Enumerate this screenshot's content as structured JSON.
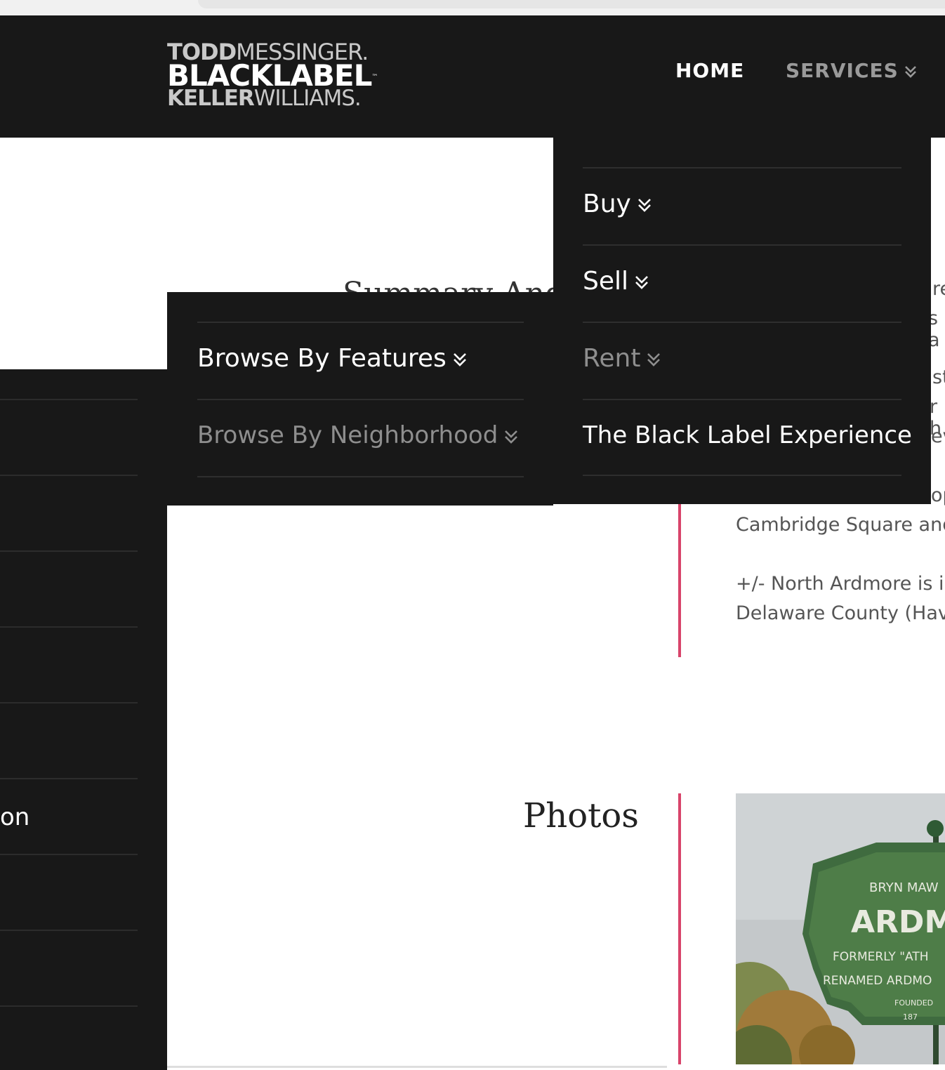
{
  "logo": {
    "line1_bold": "TODD",
    "line1_thin": "MESSINGER.",
    "line2": "BLACKLABEL",
    "line2_tm": "™",
    "line3_bold": "KELLER",
    "line3_thin": "WILLIAMS."
  },
  "nav": {
    "home": "HOME",
    "services": "SERVICES"
  },
  "services_menu": {
    "items": [
      {
        "label": "Buy"
      },
      {
        "label": "Sell"
      },
      {
        "label": "Rent"
      },
      {
        "label": "The Black Label Experience"
      }
    ]
  },
  "rent_submenu": {
    "items": [
      {
        "label": "Browse By Features"
      },
      {
        "label": "Browse By Neighborhood"
      }
    ]
  },
  "left_panel": {
    "fragment": "on"
  },
  "content": {
    "summary_title_fragment": "Summary And",
    "photos_title": "Photos",
    "right_fragments": [
      "re",
      "s a",
      "st",
      "r h",
      "ev",
      "op"
    ],
    "lines": [
      "Cambridge Square and",
      "+/- North Ardmore is in",
      "Delaware County (Have"
    ]
  },
  "photo_sign": {
    "top": "BRYN MAW",
    "main": "ARDMO",
    "sub1": "FORMERLY \"ATH",
    "sub2": "RENAMED ARDMO",
    "sub3": "FOUNDED",
    "sub4": "187"
  },
  "colors": {
    "header_bg": "#181818",
    "accent_pink": "#d8446a",
    "menu_active": "#ffffff",
    "menu_inactive": "#8e8e8e"
  }
}
